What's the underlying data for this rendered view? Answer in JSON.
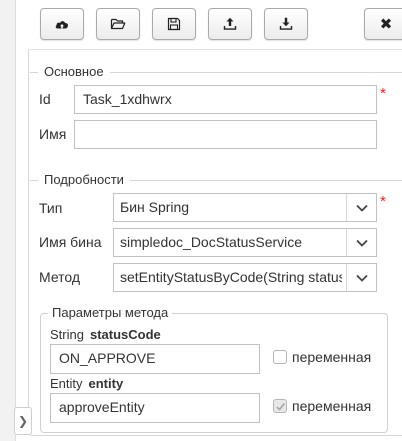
{
  "toolbar": {
    "buttons": [
      {
        "name": "upload-cloud",
        "icon": "cloud-upload-icon"
      },
      {
        "name": "open-folder",
        "icon": "folder-open-icon"
      },
      {
        "name": "save",
        "icon": "save-icon"
      },
      {
        "name": "export",
        "icon": "export-icon"
      },
      {
        "name": "import",
        "icon": "import-icon"
      }
    ],
    "close_label": "✖"
  },
  "general": {
    "legend": "Основное",
    "id_label": "Id",
    "id_value": "Task_1xdhwrx",
    "name_label": "Имя",
    "name_value": "",
    "required_mark": "*"
  },
  "details": {
    "legend": "Подробности",
    "type_label": "Тип",
    "type_value": "Бин Spring",
    "bean_label": "Имя бина",
    "bean_value": "simpledoc_DocStatusService",
    "method_label": "Метод",
    "method_value": "setEntityStatusByCode(String status",
    "required_mark": "*"
  },
  "params": {
    "legend": "Параметры метода",
    "items": [
      {
        "type": "String",
        "name": "statusCode",
        "value": "ON_APPROVE",
        "variable_label": "переменная",
        "variable_checked": false
      },
      {
        "type": "Entity",
        "name": "entity",
        "value": "approveEntity",
        "variable_label": "переменная",
        "variable_checked": true
      }
    ]
  },
  "colors": {
    "required": "#e0262c",
    "border": "#c2c2c2"
  }
}
